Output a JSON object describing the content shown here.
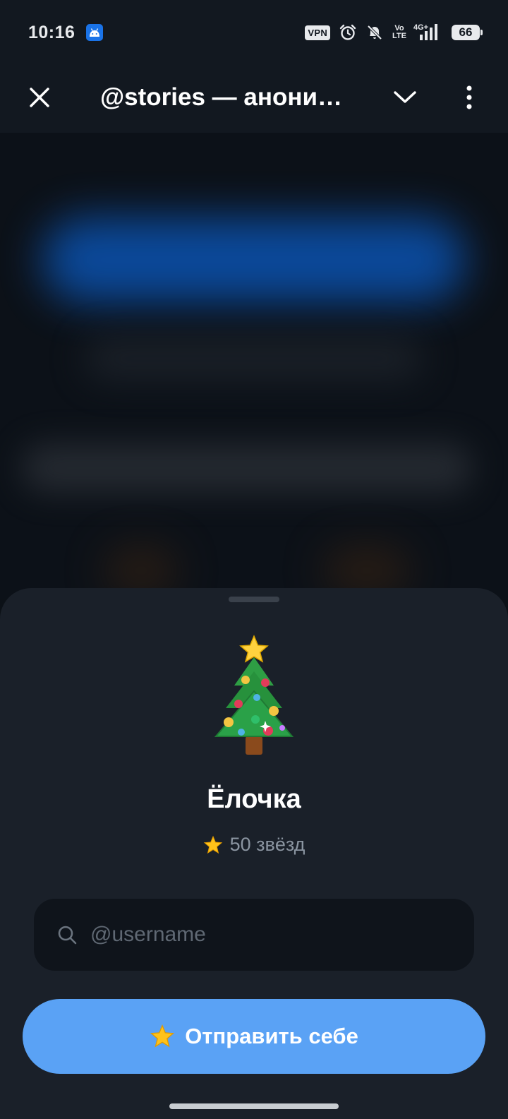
{
  "status_bar": {
    "time": "10:16",
    "vpn": "VPN",
    "volte_top": "Vo",
    "volte_bottom": "LTE",
    "network": "4G+",
    "battery": "66",
    "icons": [
      "android-icon",
      "alarm-icon",
      "mute-bell-icon",
      "signal-icon",
      "battery-icon"
    ]
  },
  "header": {
    "title": "@stories — анонимный просмотр историй",
    "close_icon": "close-icon",
    "chevron_icon": "chevron-down-icon",
    "more_icon": "more-vertical-icon"
  },
  "sheet": {
    "gift_emoji": "🎄",
    "gift_name": "Ёлочка",
    "price_icon": "star-icon",
    "price_text": "50 звёзд",
    "search": {
      "placeholder": "@username",
      "value": ""
    },
    "send_button": {
      "icon": "star-icon",
      "label": "Отправить себе"
    }
  },
  "colors": {
    "accent": "#5aa2f5",
    "sheet_bg": "#1a2029",
    "input_bg": "#0f141b",
    "muted_text": "#8b95a1"
  }
}
